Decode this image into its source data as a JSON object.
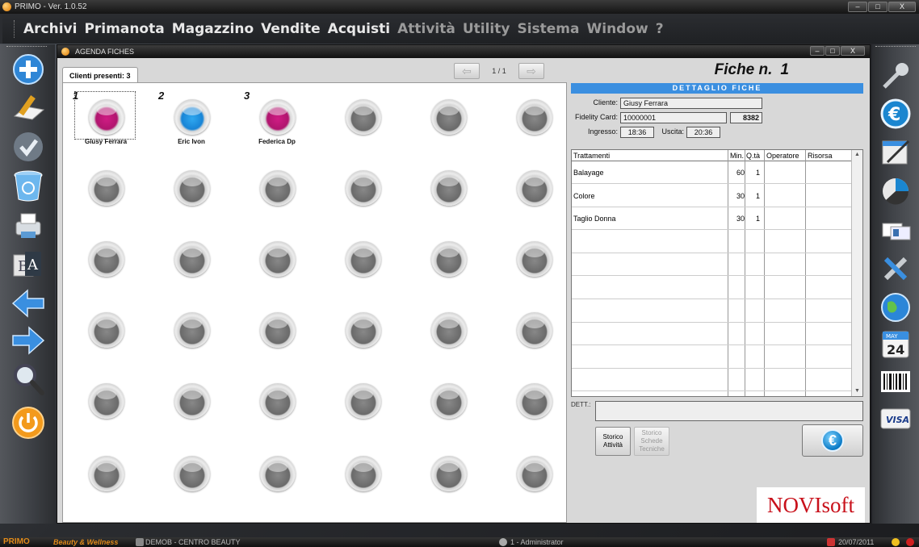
{
  "window": {
    "title": "PRIMO - Ver. 1.0.52",
    "buttons": [
      "–",
      "□",
      "X"
    ]
  },
  "menu": [
    {
      "label": "Archivi"
    },
    {
      "label": "Primanota"
    },
    {
      "label": "Magazzino"
    },
    {
      "label": "Vendite"
    },
    {
      "label": "Acquisti"
    },
    {
      "label": "Attività"
    },
    {
      "label": "Utility"
    },
    {
      "label": "Sistema"
    },
    {
      "label": "Window"
    },
    {
      "label": "?"
    }
  ],
  "left_toolbar": [
    "add-icon",
    "edit-icon",
    "confirm-icon",
    "recycle-bin-icon",
    "printer-icon",
    "translate-icon",
    "arrow-left-icon",
    "arrow-right-icon",
    "search-icon",
    "power-icon"
  ],
  "right_toolbar": [
    "key-icon",
    "euro-icon",
    "notepad-icon",
    "pie-chart-icon",
    "id-cards-icon",
    "tools-icon",
    "globe-icon",
    "calendar-icon",
    "barcode-icon",
    "visa-card-icon"
  ],
  "right_toolbar_labels": {
    "calendar_month": "MAY",
    "calendar_day": "24",
    "visa": "VISA"
  },
  "agenda": {
    "title": "AGENDA FICHES",
    "tab_label": "Clienti presenti: 3",
    "page_indicator": "1 / 1",
    "prev_glyph": "⇦",
    "next_glyph": "⇨",
    "slots": [
      {
        "num": "1",
        "name": "Giusy Ferrara",
        "color": "pink",
        "selected": true
      },
      {
        "num": "2",
        "name": "Eric Ivon",
        "color": "blue",
        "selected": false
      },
      {
        "num": "3",
        "name": "Federica Dp",
        "color": "pink",
        "selected": false
      },
      {
        "num": "",
        "name": "",
        "color": "gray",
        "selected": false
      },
      {
        "num": "",
        "name": "",
        "color": "gray",
        "selected": false
      },
      {
        "num": "",
        "name": "",
        "color": "gray",
        "selected": false
      },
      {
        "num": "",
        "name": "",
        "color": "gray",
        "selected": false
      },
      {
        "num": "",
        "name": "",
        "color": "gray",
        "selected": false
      },
      {
        "num": "",
        "name": "",
        "color": "gray",
        "selected": false
      },
      {
        "num": "",
        "name": "",
        "color": "gray",
        "selected": false
      },
      {
        "num": "",
        "name": "",
        "color": "gray",
        "selected": false
      },
      {
        "num": "",
        "name": "",
        "color": "gray",
        "selected": false
      },
      {
        "num": "",
        "name": "",
        "color": "gray",
        "selected": false
      },
      {
        "num": "",
        "name": "",
        "color": "gray",
        "selected": false
      },
      {
        "num": "",
        "name": "",
        "color": "gray",
        "selected": false
      },
      {
        "num": "",
        "name": "",
        "color": "gray",
        "selected": false
      },
      {
        "num": "",
        "name": "",
        "color": "gray",
        "selected": false
      },
      {
        "num": "",
        "name": "",
        "color": "gray",
        "selected": false
      },
      {
        "num": "",
        "name": "",
        "color": "gray",
        "selected": false
      },
      {
        "num": "",
        "name": "",
        "color": "gray",
        "selected": false
      },
      {
        "num": "",
        "name": "",
        "color": "gray",
        "selected": false
      },
      {
        "num": "",
        "name": "",
        "color": "gray",
        "selected": false
      },
      {
        "num": "",
        "name": "",
        "color": "gray",
        "selected": false
      },
      {
        "num": "",
        "name": "",
        "color": "gray",
        "selected": false
      },
      {
        "num": "",
        "name": "",
        "color": "gray",
        "selected": false
      },
      {
        "num": "",
        "name": "",
        "color": "gray",
        "selected": false
      },
      {
        "num": "",
        "name": "",
        "color": "gray",
        "selected": false
      },
      {
        "num": "",
        "name": "",
        "color": "gray",
        "selected": false
      },
      {
        "num": "",
        "name": "",
        "color": "gray",
        "selected": false
      },
      {
        "num": "",
        "name": "",
        "color": "gray",
        "selected": false
      },
      {
        "num": "",
        "name": "",
        "color": "gray",
        "selected": false
      },
      {
        "num": "",
        "name": "",
        "color": "gray",
        "selected": false
      },
      {
        "num": "",
        "name": "",
        "color": "gray",
        "selected": false
      },
      {
        "num": "",
        "name": "",
        "color": "gray",
        "selected": false
      },
      {
        "num": "",
        "name": "",
        "color": "gray",
        "selected": false
      },
      {
        "num": "",
        "name": "",
        "color": "gray",
        "selected": false
      }
    ]
  },
  "fiche": {
    "title": "Fiche n.",
    "number": "1",
    "section_title": "DETTAGLIO FICHE",
    "cliente_label": "Cliente:",
    "cliente_value": "Giusy Ferrara",
    "fidelity_label": "Fidelity Card:",
    "fidelity_value": "10000001",
    "fidelity_points": "8382",
    "ingresso_label": "Ingresso:",
    "ingresso_value": "18:36",
    "uscita_label": "Uscita:",
    "uscita_value": "20:36",
    "table": {
      "headers": [
        "Trattamenti",
        "Min.",
        "Q.tà",
        "Operatore",
        "Risorsa"
      ],
      "rows": [
        [
          "Balayage",
          "60",
          "1",
          "",
          ""
        ],
        [
          "Colore",
          "30",
          "1",
          "",
          ""
        ],
        [
          "Taglio Donna",
          "30",
          "1",
          "",
          ""
        ]
      ]
    },
    "dett_label": "DETT.:",
    "storico_attivita": "Storico Attività",
    "storico_schede": "Storico Schede Tecniche",
    "euro_glyph": "€"
  },
  "logo": {
    "text": "NOVIsoft"
  },
  "status": {
    "brand": "PRIMO",
    "brand_sub": "Beauty & Wellness",
    "db": "DEMOB - CENTRO BEAUTY",
    "user": "1 - Administrator",
    "date": "20/07/2011"
  },
  "colors": {
    "accent": "#3b8fe0",
    "pink": "#d01c84",
    "blue": "#1884d6",
    "logo": "#c8101a",
    "brand": "#e08a1a"
  }
}
